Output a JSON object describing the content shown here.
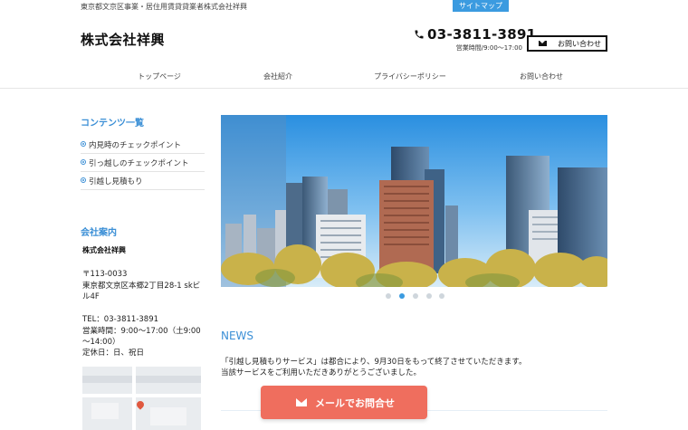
{
  "header": {
    "tagline": "東京都文京区事業・居住用賃貸貸業者株式会社祥興",
    "sitemap_label": "サイトマップ",
    "logo": "株式会社祥興",
    "phone": "03-3811-3891",
    "hours": "営業時間/9:00～17:00",
    "contact_label": "お問い合わせ"
  },
  "nav": {
    "items": [
      {
        "label": "トップページ"
      },
      {
        "label": "会社紹介"
      },
      {
        "label": "プライバシーポリシー"
      },
      {
        "label": "お問い合わせ"
      }
    ]
  },
  "sidebar": {
    "contents_title": "コンテンツ一覧",
    "items": [
      {
        "label": "内見時のチェックポイント"
      },
      {
        "label": "引っ越しのチェックポイント"
      },
      {
        "label": "引越し見積もり"
      }
    ],
    "company_title": "会社案内",
    "company_name": "株式会社祥興",
    "postal": "〒113-0033",
    "address1": "東京都文京区本郷2丁目28-1 skビ",
    "address2": "ル4F",
    "tel": "TEL：03-3811-3891",
    "hours1": "営業時間：9:00～17:00（土9:00",
    "hours2": "～14:00）",
    "holiday": "定休日：日、祝日"
  },
  "slider": {
    "dot_count": 5,
    "active_index": 1
  },
  "news": {
    "title": "NEWS",
    "line1": "「引越し見積もりサービス」は都合により、9月30日をもって終了させていただきます。",
    "line2": "当該サービスをご利用いただきありがとうございました。"
  },
  "cta": {
    "label": "メールでお問合せ"
  },
  "colors": {
    "accent": "#3b8fd6",
    "sitemap_bg": "#3b9be0",
    "cta_bg": "#ef6e5e"
  }
}
